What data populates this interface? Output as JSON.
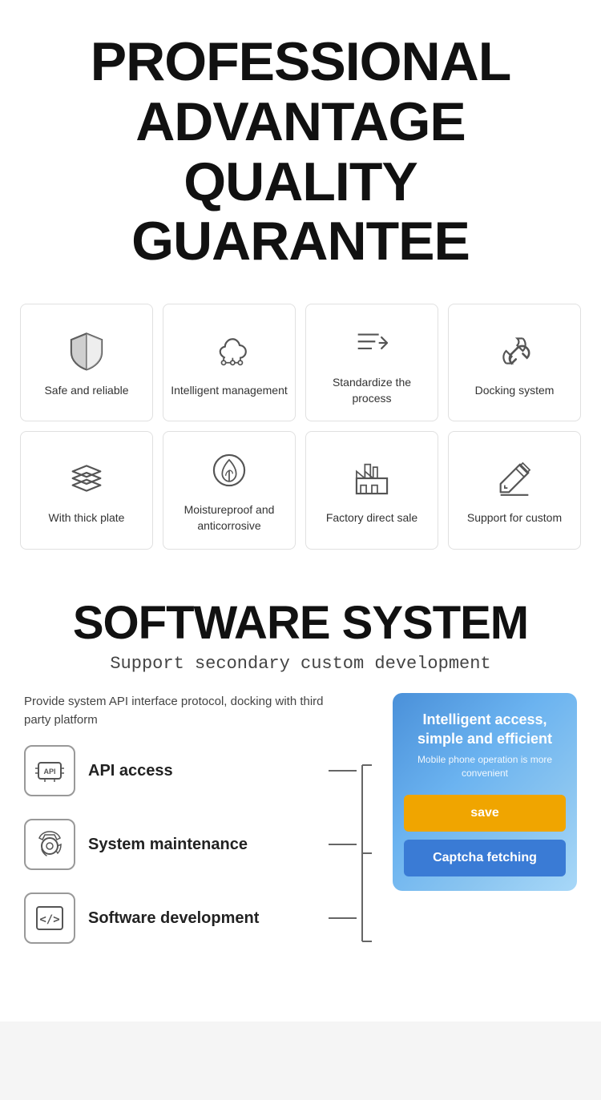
{
  "header": {
    "line1": "PROFESSIONAL",
    "line2": "ADVANTAGE",
    "line3": "QUALITY GUARANTEE"
  },
  "features": {
    "row1": [
      {
        "id": "safe-reliable",
        "label": "Safe and reliable",
        "icon": "shield"
      },
      {
        "id": "intelligent-management",
        "label": "Intelligent management",
        "icon": "cloud"
      },
      {
        "id": "standardize-process",
        "label": "Standardize the process",
        "icon": "arrow-list"
      },
      {
        "id": "docking-system",
        "label": "Docking system",
        "icon": "link"
      }
    ],
    "row2": [
      {
        "id": "thick-plate",
        "label": "With thick plate",
        "icon": "layers"
      },
      {
        "id": "moistureproof",
        "label": "Moistureproof and anticorrosive",
        "icon": "shield-plant"
      },
      {
        "id": "factory-direct",
        "label": "Factory direct sale",
        "icon": "factory"
      },
      {
        "id": "support-custom",
        "label": "Support for custom",
        "icon": "edit-tools"
      }
    ]
  },
  "software": {
    "title": "SOFTWARE SYSTEM",
    "subtitle": "Support secondary custom development",
    "description": "Provide system API interface protocol, docking with third party platform",
    "items": [
      {
        "id": "api-access",
        "label": "API access",
        "icon": "api"
      },
      {
        "id": "system-maintenance",
        "label": "System maintenance",
        "icon": "maintenance"
      },
      {
        "id": "software-development",
        "label": "Software development",
        "icon": "code"
      }
    ],
    "panel": {
      "main_text": "Intelligent access, simple and efficient",
      "sub_text": "Mobile phone operation is more convenient",
      "save_button": "save",
      "captcha_button": "Captcha fetching"
    }
  }
}
